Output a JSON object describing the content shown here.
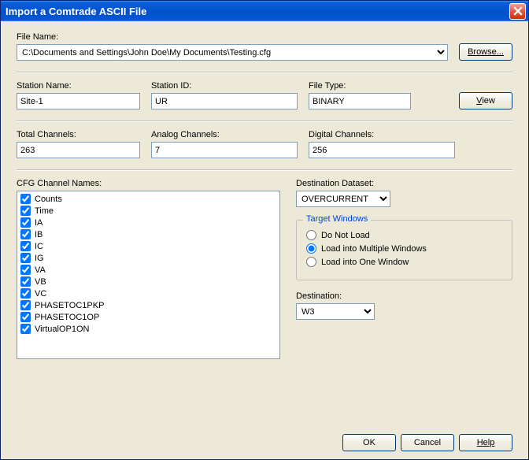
{
  "title": "Import a Comtrade ASCII File",
  "filename": {
    "label": "File Name:",
    "value": "C:\\Documents and Settings\\John Doe\\My Documents\\Testing.cfg",
    "browse": "Browse..."
  },
  "station_name": {
    "label": "Station Name:",
    "value": "Site-1"
  },
  "station_id": {
    "label": "Station ID:",
    "value": "UR"
  },
  "file_type": {
    "label": "File Type:",
    "value": "BINARY",
    "view": "View"
  },
  "total_channels": {
    "label": "Total Channels:",
    "value": "263"
  },
  "analog_channels": {
    "label": "Analog Channels:",
    "value": "7"
  },
  "digital_channels": {
    "label": "Digital Channels:",
    "value": "256"
  },
  "cfg": {
    "label": "CFG Channel Names:",
    "items": [
      {
        "label": "Counts",
        "checked": true
      },
      {
        "label": "Time",
        "checked": true
      },
      {
        "label": "IA",
        "checked": true
      },
      {
        "label": "IB",
        "checked": true
      },
      {
        "label": "IC",
        "checked": true
      },
      {
        "label": "IG",
        "checked": true
      },
      {
        "label": "VA",
        "checked": true
      },
      {
        "label": "VB",
        "checked": true
      },
      {
        "label": "VC",
        "checked": true
      },
      {
        "label": "PHASETOC1PKP",
        "checked": true
      },
      {
        "label": "PHASETOC1OP",
        "checked": true
      },
      {
        "label": "VirtualOP1ON",
        "checked": true
      }
    ]
  },
  "dataset": {
    "label": "Destination Dataset:",
    "value": "OVERCURRENT"
  },
  "target": {
    "label": "Target Windows",
    "options": [
      {
        "label": "Do Not Load",
        "checked": false
      },
      {
        "label": "Load into Multiple Windows",
        "checked": true
      },
      {
        "label": "Load into One Window",
        "checked": false
      }
    ]
  },
  "destination": {
    "label": "Destination:",
    "value": "W3"
  },
  "footer": {
    "ok": "OK",
    "cancel": "Cancel",
    "help": "Help"
  }
}
